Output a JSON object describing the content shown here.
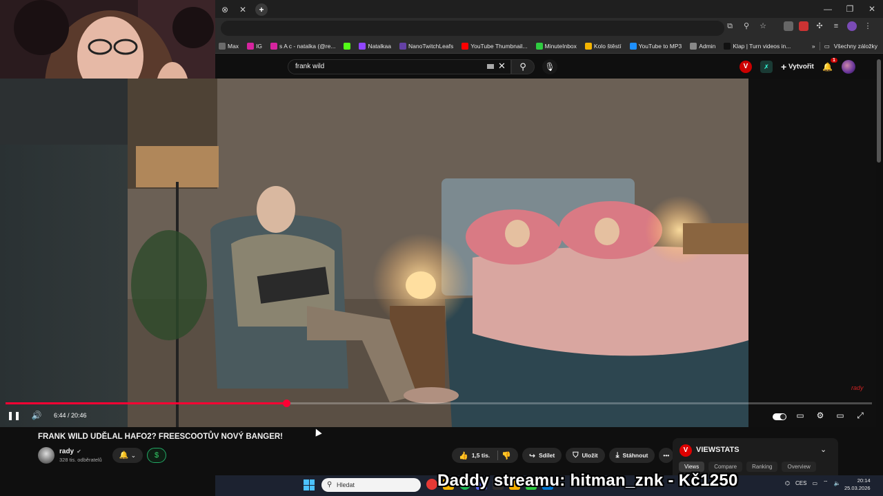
{
  "browser": {
    "tab_controls": [
      "⊗",
      "✕",
      "+"
    ],
    "window_controls": [
      "—",
      "❐",
      "✕"
    ],
    "bookmarks": [
      {
        "label": "Max",
        "color": "#6b6b6b"
      },
      {
        "label": "IG",
        "color": "#d6249f"
      },
      {
        "label": "s A c - natalka (@re...",
        "color": "#d6249f"
      },
      {
        "label": "",
        "color": "#53fc18"
      },
      {
        "label": "Natalkaa",
        "color": "#9146ff"
      },
      {
        "label": "NanoTwitchLeafs",
        "color": "#6441a5"
      },
      {
        "label": "YouTube Thumbnail...",
        "color": "#ff0000"
      },
      {
        "label": "MinuteInbox",
        "color": "#2ecc40"
      },
      {
        "label": "Kolo štěstí",
        "color": "#f4b400"
      },
      {
        "label": "YouTube to MP3",
        "color": "#1e90ff"
      },
      {
        "label": "Admin",
        "color": "#888888"
      },
      {
        "label": "Klap | Turn videos in...",
        "color": "#111111"
      }
    ],
    "bookmarks_more": "»",
    "all_bookmarks_label": "Všechny záložky"
  },
  "youtube": {
    "search_value": "frank wild",
    "create_label": "Vytvořit",
    "notification_count": "1",
    "video": {
      "title": "FRANK WILD UDĚLAL HAFO2? FREESCOOTŮV NOVÝ BANGER!",
      "time": "6:44 / 20:46",
      "progress_fraction": 0.324,
      "watermark": "rady"
    },
    "channel": {
      "name": "rady",
      "subscribers": "328 tis. odběratelů"
    },
    "actions": {
      "likes": "1,5 tis.",
      "share": "Sdílet",
      "save": "Uložit",
      "download": "Stáhnout",
      "more": "•••"
    }
  },
  "viewstats": {
    "logo": "V",
    "title": "VIEWSTATS",
    "tabs": [
      "Views",
      "Compare",
      "Ranking",
      "Overview"
    ],
    "active_tab": "Views"
  },
  "taskbar": {
    "search_placeholder": "Hledat",
    "stream_overlay": "Daddy streamu: hitman_znk - Kč1250",
    "language": "CES",
    "time": "20:14",
    "date": "25.03.2026"
  },
  "colors": {
    "accent_red": "#ff0033",
    "background": "#0f0f0f",
    "pill": "#272727"
  }
}
